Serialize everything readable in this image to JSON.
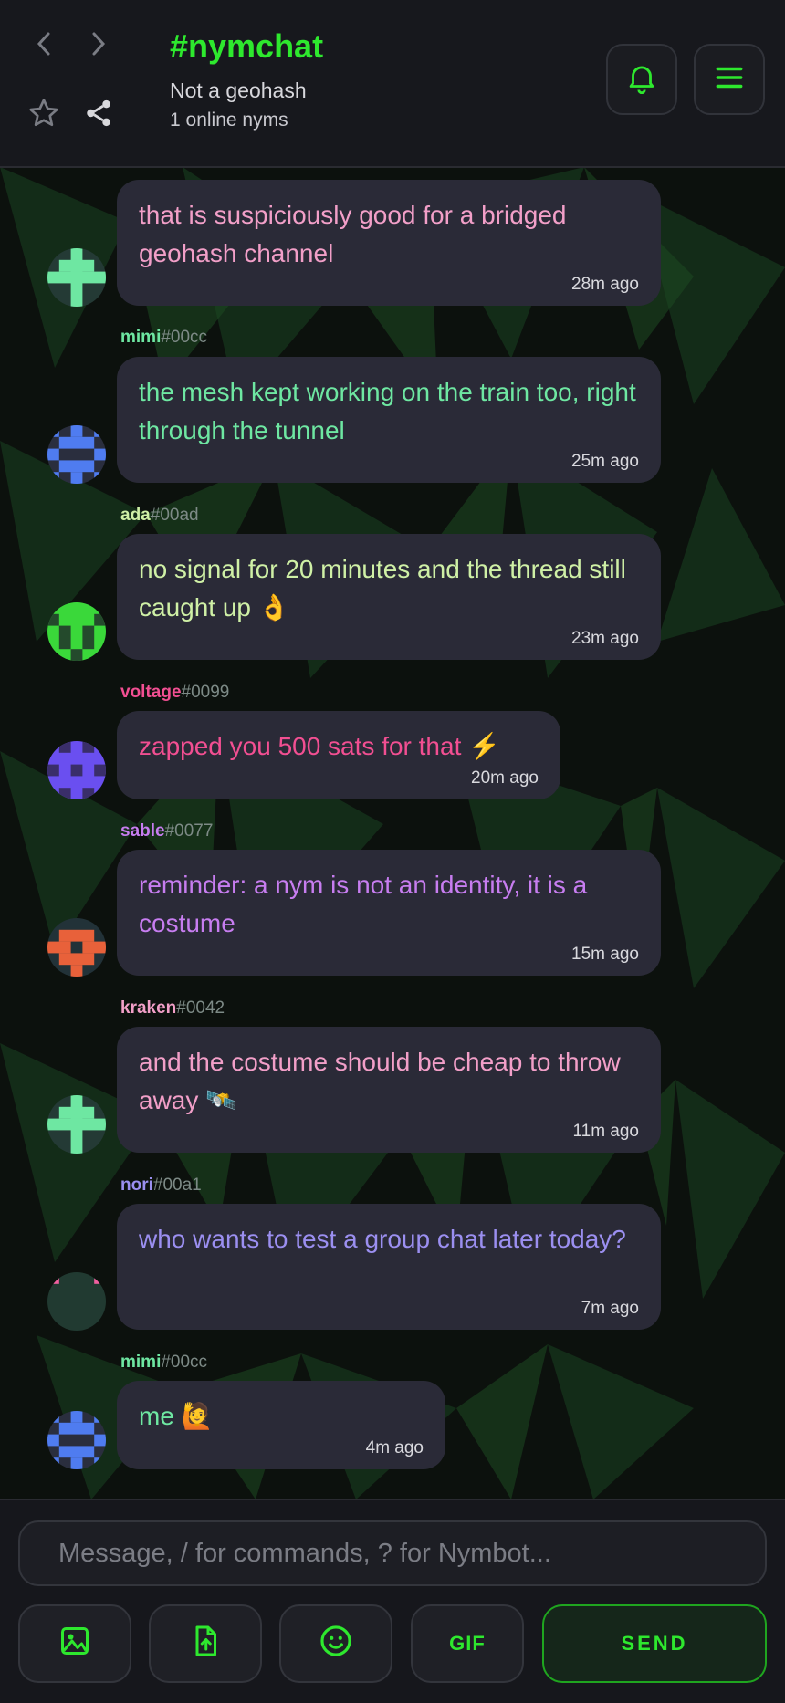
{
  "header": {
    "title": "#nymchat",
    "subtitle": "Not a geohash",
    "online": "1 online nyms",
    "icons": [
      "chevron-left-icon",
      "chevron-right-icon",
      "star-icon",
      "share-icon",
      "bell-icon",
      "menu-icon"
    ]
  },
  "colors": {
    "accent": "#2ee82e",
    "bubble": "#2a2a37",
    "header_bg": "#17181d"
  },
  "messages": [
    {
      "author": "",
      "tag": "",
      "text": "that is suspiciously good for a bridged geohash channel",
      "time": "28m ago",
      "color": "#f29fc8",
      "avatar": "#6ee7a2"
    },
    {
      "author": "mimi",
      "tag": "#00cc",
      "text": "the mesh kept working on the train too, right through the tunnel",
      "time": "25m ago",
      "color": "#6ee7a2",
      "avatar": "#4f7cf0"
    },
    {
      "author": "ada",
      "tag": "#00ad",
      "text": "no signal for 20 minutes and the thread still caught up 👌",
      "time": "23m ago",
      "color": "#cff0a6",
      "avatar": "#3ad83a"
    },
    {
      "author": "voltage",
      "tag": "#0099",
      "text": "zapped you 500 sats for that ⚡",
      "time": "20m ago",
      "color": "#f24f92",
      "avatar": "#6a4ff0"
    },
    {
      "author": "sable",
      "tag": "#0077",
      "text": "reminder: a nym is not an identity, it is a costume",
      "time": "15m ago",
      "color": "#c77df0",
      "avatar": "#e8613a"
    },
    {
      "author": "kraken",
      "tag": "#0042",
      "text": "and the costume should be cheap to throw away 🛰️",
      "time": "11m ago",
      "color": "#f29fc8",
      "avatar": "#6ee7a2"
    },
    {
      "author": "nori",
      "tag": "#00a1",
      "text": "who wants to test a group chat later today?",
      "time": "7m ago",
      "color": "#9b8ff0",
      "avatar": "#f25fa0"
    },
    {
      "author": "mimi",
      "tag": "#00cc",
      "text": "me 🙋",
      "time": "4m ago",
      "color": "#6ee7a2",
      "avatar": "#4f7cf0"
    }
  ],
  "composer": {
    "placeholder": "Message, / for commands, ? for Nymbot...",
    "gif_label": "GIF",
    "send_label": "SEND",
    "icons": [
      "image-icon",
      "file-upload-icon",
      "emoji-icon"
    ]
  }
}
